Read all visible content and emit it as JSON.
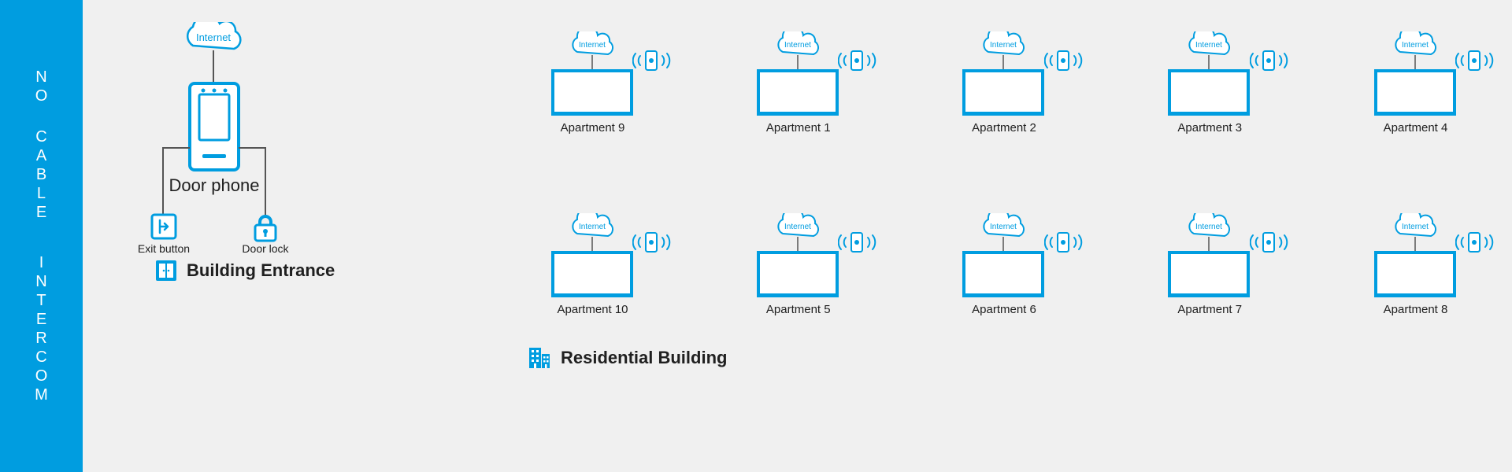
{
  "sidebar": {
    "word1": "NO",
    "word2": "CABLE",
    "word3": "INTERCOM"
  },
  "entrance": {
    "internet_label": "Internet",
    "door_phone_label": "Door phone",
    "exit_button_label": "Exit button",
    "door_lock_label": "Door lock",
    "section_label": "Building Entrance"
  },
  "residential": {
    "section_label": "Residential Building",
    "internet_label": "Internet",
    "apartments_row1": [
      {
        "label": "Apartment 9"
      },
      {
        "label": "Apartment 1"
      },
      {
        "label": "Apartment 2"
      },
      {
        "label": "Apartment 3"
      },
      {
        "label": "Apartment 4"
      }
    ],
    "apartments_row2": [
      {
        "label": "Apartment 10"
      },
      {
        "label": "Apartment 5"
      },
      {
        "label": "Apartment 6"
      },
      {
        "label": "Apartment 7"
      },
      {
        "label": "Apartment 8"
      }
    ]
  },
  "colors": {
    "accent": "#009de0"
  }
}
